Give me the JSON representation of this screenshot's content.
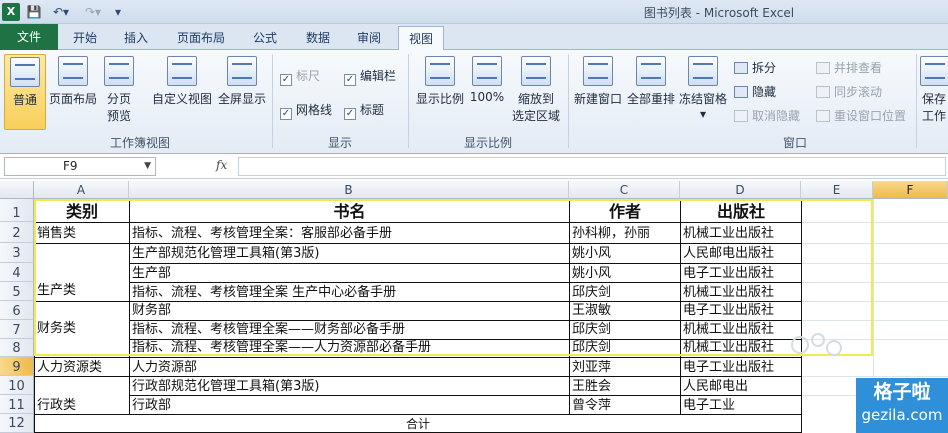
{
  "window": {
    "title": "图书列表 - Microsoft Excel",
    "app_logo": "X"
  },
  "quick_access": {
    "save_icon": "💾",
    "undo_icon": "↶▾",
    "redo_icon": "↷▾",
    "more_icon": "▾"
  },
  "tabs": [
    {
      "label": "文件"
    },
    {
      "label": "开始"
    },
    {
      "label": "插入"
    },
    {
      "label": "页面布局"
    },
    {
      "label": "公式"
    },
    {
      "label": "数据"
    },
    {
      "label": "审阅"
    },
    {
      "label": "视图"
    }
  ],
  "ribbon": {
    "workbook_views": {
      "label": "工作簿视图",
      "normal": "普通",
      "page_layout": "页面布局",
      "page_break_1": "分页",
      "page_break_2": "预览",
      "custom": "自定义视图",
      "fullscreen": "全屏显示"
    },
    "show": {
      "label": "显示",
      "ruler": "标尺",
      "formula_bar": "编辑栏",
      "gridlines": "网格线",
      "headings": "标题"
    },
    "zoom": {
      "label": "显示比例",
      "zoom": "显示比例",
      "hundred": "100%",
      "zoom_sel_1": "缩放到",
      "zoom_sel_2": "选定区域"
    },
    "window": {
      "label": "窗口",
      "new_window": "新建窗口",
      "arrange_all": "全部重排",
      "freeze": "冻结窗格",
      "split": "拆分",
      "hide": "隐藏",
      "unhide": "取消隐藏",
      "side_by_side": "并排查看",
      "sync_scroll": "同步滚动",
      "reset_pos": "重设窗口位置",
      "save_ws_1": "保存",
      "save_ws_2": "工作"
    }
  },
  "formula_bar": {
    "name_box": "F9",
    "fx": "fx"
  },
  "columns": [
    "A",
    "B",
    "C",
    "D",
    "E",
    "F"
  ],
  "rows": [
    "1",
    "2",
    "3",
    "4",
    "5",
    "6",
    "7",
    "8",
    "9",
    "10",
    "11",
    "12"
  ],
  "header_row": {
    "category": "类别",
    "title": "书名",
    "author": "作者",
    "publisher": "出版社"
  },
  "categories": {
    "sales": "销售类",
    "production": "生产类",
    "finance": "财务类",
    "hr": "人力资源类",
    "admin": "行政类"
  },
  "books": [
    {
      "title": "指标、流程、考核管理全案：客服部必备手册",
      "author": "孙科柳，孙丽",
      "publisher": "机械工业出版社"
    },
    {
      "title": "生产部规范化管理工具箱(第3版)",
      "author": "姚小风",
      "publisher": "人民邮电出版社"
    },
    {
      "title": "生产部",
      "author": "姚小风",
      "publisher": "电子工业出版社"
    },
    {
      "title": "指标、流程、考核管理全案 生产中心必备手册",
      "author": "邱庆剑",
      "publisher": "机械工业出版社"
    },
    {
      "title": "财务部",
      "author": "王淑敏",
      "publisher": "电子工业出版社"
    },
    {
      "title": "指标、流程、考核管理全案——财务部必备手册",
      "author": "邱庆剑",
      "publisher": "机械工业出版社"
    },
    {
      "title": "指标、流程、考核管理全案——人力资源部必备手册",
      "author": "邱庆剑",
      "publisher": "机械工业出版社"
    },
    {
      "title": "人力资源部",
      "author": "刘亚萍",
      "publisher": "电子工业出版社"
    },
    {
      "title": "行政部规范化管理工具箱(第3版)",
      "author": "王胜会",
      "publisher": "人民邮电出"
    },
    {
      "title": "行政部",
      "author": "曾令萍",
      "publisher": "电子工业"
    }
  ],
  "total_label": "合计",
  "watermark": {
    "line1": "格子啦",
    "line2": "gezila.com"
  },
  "colors": {
    "file_tab": "#1f7244",
    "selection_border": "#f2ea4a",
    "watermark_bg": "#2f8fd8"
  }
}
